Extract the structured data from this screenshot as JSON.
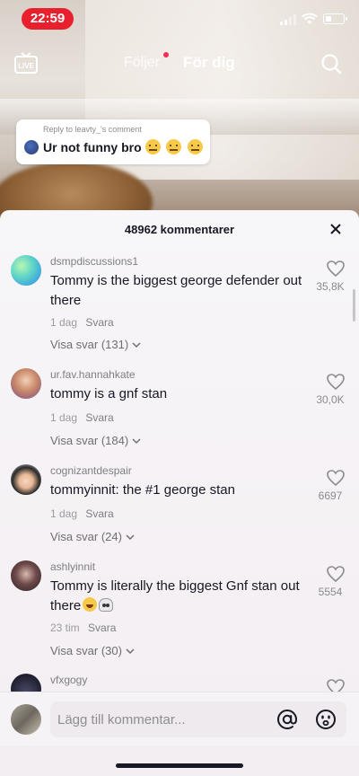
{
  "status_bar": {
    "time": "22:59"
  },
  "nav": {
    "live_label": "LIVE",
    "following_label": "Följer",
    "for_you_label": "För dig"
  },
  "reply_sticker": {
    "reply_to": "Reply to leavty_'s comment",
    "text": "Ur not funny bro"
  },
  "comments_sheet": {
    "count_label": "48962 kommentarer",
    "comments": [
      {
        "username": "dsmpdiscussions1",
        "text": "Tommy is the biggest george defender out there",
        "age": "1 dag",
        "reply_label": "Svara",
        "view_replies": "Visa svar (131)",
        "likes": "35,8K"
      },
      {
        "username": "ur.fav.hannahkate",
        "text": "tommy is a gnf stan",
        "age": "1 dag",
        "reply_label": "Svara",
        "view_replies": "Visa svar (184)",
        "likes": "30,0K"
      },
      {
        "username": "cognizantdespair",
        "text": "tommyinnit: the #1 george stan",
        "age": "1 dag",
        "reply_label": "Svara",
        "view_replies": "Visa svar (24)",
        "likes": "6697"
      },
      {
        "username": "ashlyinnit",
        "text": "Tommy is literally the biggest Gnf stan out there",
        "age": "23 tim",
        "reply_label": "Svara",
        "view_replies": "Visa svar (30)",
        "likes": "5554"
      },
      {
        "username": "vfxgogy",
        "text": "",
        "age": "",
        "reply_label": "",
        "view_replies": "",
        "likes": ""
      }
    ]
  },
  "input_bar": {
    "placeholder": "Lägg till kommentar..."
  },
  "colors": {
    "accent": "#fe2c55",
    "time_pill": "#e8202e",
    "text_primary": "#161823",
    "text_secondary": "#8a8a8f"
  },
  "icons": [
    "live-icon",
    "search-icon",
    "close-icon",
    "heart-icon",
    "mention-icon",
    "emoji-icon"
  ]
}
